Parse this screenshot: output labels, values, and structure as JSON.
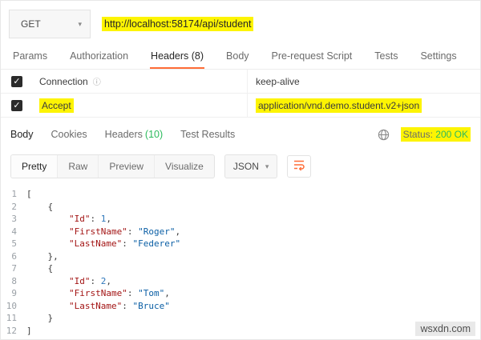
{
  "request": {
    "method": "GET",
    "url": "http://localhost:58174/api/student",
    "tabs": [
      {
        "label": "Params",
        "active": false
      },
      {
        "label": "Authorization",
        "active": false
      },
      {
        "label": "Headers (8)",
        "active": true
      },
      {
        "label": "Body",
        "active": false
      },
      {
        "label": "Pre-request Script",
        "active": false
      },
      {
        "label": "Tests",
        "active": false
      },
      {
        "label": "Settings",
        "active": false
      }
    ],
    "headers": [
      {
        "key": "Connection",
        "value": "keep-alive",
        "checked": true,
        "info": true,
        "highlight_key": false,
        "highlight_value": false
      },
      {
        "key": "Accept",
        "value": "application/vnd.demo.student.v2+json",
        "checked": true,
        "info": false,
        "highlight_key": true,
        "highlight_value": true
      }
    ]
  },
  "response": {
    "tabs": [
      {
        "label": "Body",
        "count": "",
        "active": true
      },
      {
        "label": "Cookies",
        "count": "",
        "active": false
      },
      {
        "label": "Headers",
        "count": "(10)",
        "active": false
      },
      {
        "label": "Test Results",
        "count": "",
        "active": false
      }
    ],
    "status": {
      "label": "Status:",
      "value": "200 OK"
    },
    "view_tabs": [
      {
        "label": "Pretty",
        "active": true
      },
      {
        "label": "Raw",
        "active": false
      },
      {
        "label": "Preview",
        "active": false
      },
      {
        "label": "Visualize",
        "active": false
      }
    ],
    "format_select": "JSON"
  },
  "code": {
    "lines": [
      {
        "n": "1",
        "tokens": [
          {
            "t": "p",
            "v": "["
          }
        ]
      },
      {
        "n": "2",
        "tokens": [
          {
            "t": "p",
            "v": "    {"
          }
        ]
      },
      {
        "n": "3",
        "tokens": [
          {
            "t": "p",
            "v": "        "
          },
          {
            "t": "k",
            "v": "\"Id\""
          },
          {
            "t": "p",
            "v": ": "
          },
          {
            "t": "n",
            "v": "1"
          },
          {
            "t": "p",
            "v": ","
          }
        ]
      },
      {
        "n": "4",
        "tokens": [
          {
            "t": "p",
            "v": "        "
          },
          {
            "t": "k",
            "v": "\"FirstName\""
          },
          {
            "t": "p",
            "v": ": "
          },
          {
            "t": "s",
            "v": "\"Roger\""
          },
          {
            "t": "p",
            "v": ","
          }
        ]
      },
      {
        "n": "5",
        "tokens": [
          {
            "t": "p",
            "v": "        "
          },
          {
            "t": "k",
            "v": "\"LastName\""
          },
          {
            "t": "p",
            "v": ": "
          },
          {
            "t": "s",
            "v": "\"Federer\""
          }
        ]
      },
      {
        "n": "6",
        "tokens": [
          {
            "t": "p",
            "v": "    },"
          }
        ]
      },
      {
        "n": "7",
        "tokens": [
          {
            "t": "p",
            "v": "    {"
          }
        ]
      },
      {
        "n": "8",
        "tokens": [
          {
            "t": "p",
            "v": "        "
          },
          {
            "t": "k",
            "v": "\"Id\""
          },
          {
            "t": "p",
            "v": ": "
          },
          {
            "t": "n",
            "v": "2"
          },
          {
            "t": "p",
            "v": ","
          }
        ]
      },
      {
        "n": "9",
        "tokens": [
          {
            "t": "p",
            "v": "        "
          },
          {
            "t": "k",
            "v": "\"FirstName\""
          },
          {
            "t": "p",
            "v": ": "
          },
          {
            "t": "s",
            "v": "\"Tom\""
          },
          {
            "t": "p",
            "v": ","
          }
        ]
      },
      {
        "n": "10",
        "tokens": [
          {
            "t": "p",
            "v": "        "
          },
          {
            "t": "k",
            "v": "\"LastName\""
          },
          {
            "t": "p",
            "v": ": "
          },
          {
            "t": "s",
            "v": "\"Bruce\""
          }
        ]
      },
      {
        "n": "11",
        "tokens": [
          {
            "t": "p",
            "v": "    }"
          }
        ]
      },
      {
        "n": "12",
        "tokens": [
          {
            "t": "p",
            "v": "]"
          }
        ]
      }
    ]
  },
  "icons": {
    "method_chevron": "▾",
    "format_chevron": "▾",
    "check": "✓",
    "info": "ⓘ"
  },
  "colors": {
    "accent": "#ff6c37",
    "highlight": "#fdf403",
    "success": "#2cbb5d"
  },
  "watermark": "wsxdn.com"
}
